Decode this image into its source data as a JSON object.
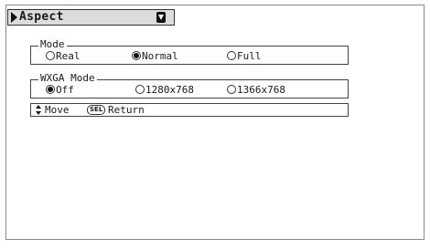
{
  "menu": {
    "title": "Aspect"
  },
  "mode_group": {
    "legend": "Mode",
    "options": [
      {
        "label": "Real",
        "checked": false
      },
      {
        "label": "Normal",
        "checked": true
      },
      {
        "label": "Full",
        "checked": false
      }
    ]
  },
  "wxga_group": {
    "legend": "WXGA Mode",
    "options": [
      {
        "label": "Off",
        "checked": true
      },
      {
        "label": "1280x768",
        "checked": false
      },
      {
        "label": "1366x768",
        "checked": false
      }
    ]
  },
  "help": {
    "move_label": "Move",
    "sel_key": "SEL",
    "return_label": "Return"
  }
}
